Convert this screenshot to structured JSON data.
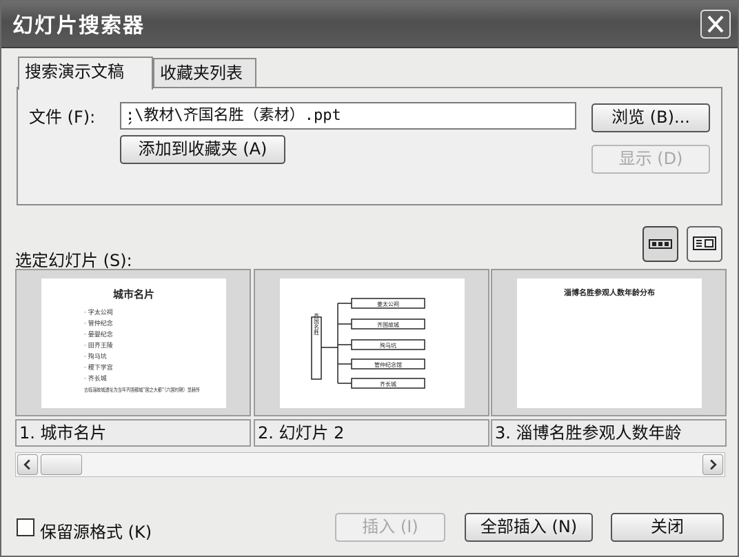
{
  "window": {
    "title": "幻灯片搜索器"
  },
  "tabs": [
    {
      "label": "搜索演示文稿"
    },
    {
      "label": "收藏夹列表"
    }
  ],
  "file": {
    "label": "文件 (F):",
    "value": "̗:\\教材\\齐国名胜（素材）.ppt",
    "browse_label": "浏览 (B)...",
    "add_favorites_label": "添加到收藏夹 (A)",
    "show_label": "显示 (D)"
  },
  "slides": {
    "label": "选定幻灯片 (S):",
    "items": [
      {
        "caption": "1.  城市名片",
        "title": "城市名片",
        "bullets": [
          "·   字太公祠",
          "·   管仲纪念",
          "·   晏婴纪念",
          "·   田齐王陵",
          "·   殉马坑",
          "·   稷下学宫",
          "·   齐长城"
        ],
        "note": "古临淄故城遗址为当年齐国都城“国之大都”（六国时期）显赫所"
      },
      {
        "caption": "2.  幻灯片 2",
        "side_text": "齐国名胜",
        "boxes": [
          "姜太公祠",
          "齐国故城",
          "殉马坑",
          "管仲纪念馆",
          "齐长城"
        ]
      },
      {
        "caption": "3.  淄博名胜参观人数年龄",
        "title": "淄博名胜参观人数年龄分布"
      }
    ]
  },
  "keep_format": {
    "label": "保留源格式 (K)",
    "checked": false
  },
  "buttons": {
    "insert": "插入 (I)",
    "insert_all": "全部插入 (N)",
    "close": "关闭"
  },
  "icons": {
    "close": "close-x-icon",
    "view_filmstrip": "filmstrip-view-icon",
    "view_list": "list-view-icon",
    "scroll_left": "arrow-left-icon",
    "scroll_right": "arrow-right-icon"
  }
}
